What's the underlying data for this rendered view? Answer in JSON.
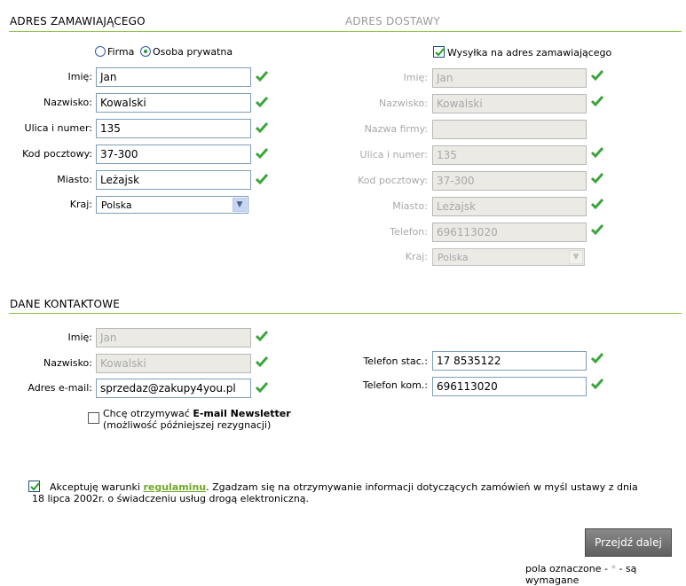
{
  "orderer": {
    "title": "ADRES ZAMAWIAJĄCEGO",
    "type_company": "Firma",
    "type_private": "Osoba prywatna",
    "fields": [
      {
        "label": "Imię:",
        "value": "Jan"
      },
      {
        "label": "Nazwisko:",
        "value": "Kowalski"
      },
      {
        "label": "Ulica i numer:",
        "value": "135"
      },
      {
        "label": "Kod pocztowy:",
        "value": "37-300"
      },
      {
        "label": "Miasto:",
        "value": "Leżajsk"
      }
    ],
    "country_label": "Kraj:",
    "country_value": "Polska"
  },
  "delivery": {
    "title": "ADRES DOSTAWY",
    "same_address_label": "Wysyłka na adres zamawiającego",
    "fields": [
      {
        "label": "Imię:",
        "value": "Jan"
      },
      {
        "label": "Nazwisko:",
        "value": "Kowalski"
      },
      {
        "label": "Nazwa firmy:",
        "value": ""
      },
      {
        "label": "Ulica i numer:",
        "value": "135"
      },
      {
        "label": "Kod pocztowy:",
        "value": "37-300"
      },
      {
        "label": "Miasto:",
        "value": "Leżajsk"
      },
      {
        "label": "Telefon:",
        "value": "696113020"
      }
    ],
    "country_label": "Kraj:",
    "country_value": "Polska"
  },
  "contact": {
    "title": "DANE KONTAKTOWE",
    "fields": [
      {
        "label": "Imię:",
        "value": "Jan"
      },
      {
        "label": "Nazwisko:",
        "value": "Kowalski"
      },
      {
        "label": "Adres e-mail:",
        "value": "sprzedaz@zakupy4you.pl"
      }
    ],
    "phones": [
      {
        "label": "Telefon stac.:",
        "value": "17 8535122"
      },
      {
        "label": "Telefon kom.:",
        "value": "696113020"
      }
    ],
    "newsletter_prefix": "Chcę otrzymywać ",
    "newsletter_bold": "E-mail Newsletter",
    "newsletter_note": "(możliwość późniejszej rezygnacji)"
  },
  "terms": {
    "prefix": "Akceptuję warunki ",
    "link": "regulaminu",
    "suffix": ". Zgadzam się na otrzymywanie informacji dotyczących zamówień w myśl ustawy z dnia 18 lipca 2002r. o świadczeniu usług drogą elektroniczną."
  },
  "submit_label": "Przejdź dalej",
  "required_note_prefix": "pola oznaczone - ",
  "required_mark": "*",
  "required_note_suffix": " - są wymagane",
  "colors": {
    "accent": "#8cc540",
    "check": "#3aa53a"
  }
}
